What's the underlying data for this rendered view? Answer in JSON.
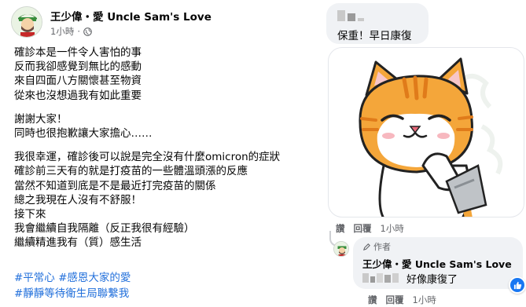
{
  "post": {
    "author": "王少偉・愛 Uncle Sam's Love",
    "time": "1小時",
    "privacy_icon": "globe-icon",
    "lines_1": [
      "確診本是一件令人害怕的事",
      "反而我卻感覺到無比的感動",
      "來自四面八方關懷甚至物資",
      "從來也沒想過我有如此重要"
    ],
    "lines_2": [
      "謝謝大家！",
      "同時也很抱歉讓大家擔心……"
    ],
    "lines_3": [
      "我很幸運，確診後可以說是完全沒有什麼omicron的症狀",
      "確診前三天有的就是打疫苗的一些體溫頭漲的反應",
      "當然不知道到底是不是最近打完疫苗的關係",
      "總之我現在人沒有不舒服！",
      "接下來",
      "我會繼續自我隔離（反正我很有經驗）",
      "繼續精進我有（質）感生活"
    ],
    "hashtags": [
      "#平常心 #感恩大家的愛",
      "#靜靜等待衛生局聯繫我"
    ]
  },
  "comment1": {
    "text": "保重！早日康復",
    "actions": {
      "like": "讚",
      "reply": "回覆",
      "time": "1小時"
    }
  },
  "reply": {
    "badge": "作者",
    "author": "王少偉・愛 Uncle Sam's Love",
    "text": "好像康復了",
    "actions": {
      "like": "讚",
      "reply": "回覆",
      "time": "1小時"
    },
    "reaction_icon": "like-icon"
  },
  "colors": {
    "hashtag": "#216fdb",
    "bubble": "#f0f2f5",
    "meta": "#65676b",
    "like": "#1877f2",
    "cat_orange": "#f4a63a"
  }
}
